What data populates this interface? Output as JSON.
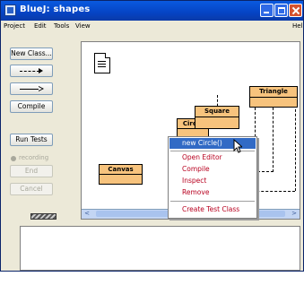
{
  "window": {
    "title": "BlueJ: shapes"
  },
  "menubar": {
    "items": [
      "Project",
      "Edit",
      "Tools",
      "View"
    ],
    "help": "Help"
  },
  "toolbar": {
    "new_class": "New Class...",
    "compile": "Compile",
    "run_tests": "Run Tests",
    "recording": "recording",
    "end": "End",
    "cancel": "Cancel"
  },
  "classes": {
    "circle": "Circle",
    "square": "Square",
    "triangle": "Triangle",
    "canvas": "Canvas"
  },
  "context_menu": {
    "items": [
      "new Circle()",
      "Open Editor",
      "Compile",
      "Inspect",
      "Remove",
      "Create Test Class"
    ],
    "selected": "new Circle()"
  },
  "colors": {
    "class_fill": "#f7c37d",
    "menu_text": "#b8001f",
    "menu_highlight": "#316ac5",
    "title_bar": "#0544c4"
  }
}
